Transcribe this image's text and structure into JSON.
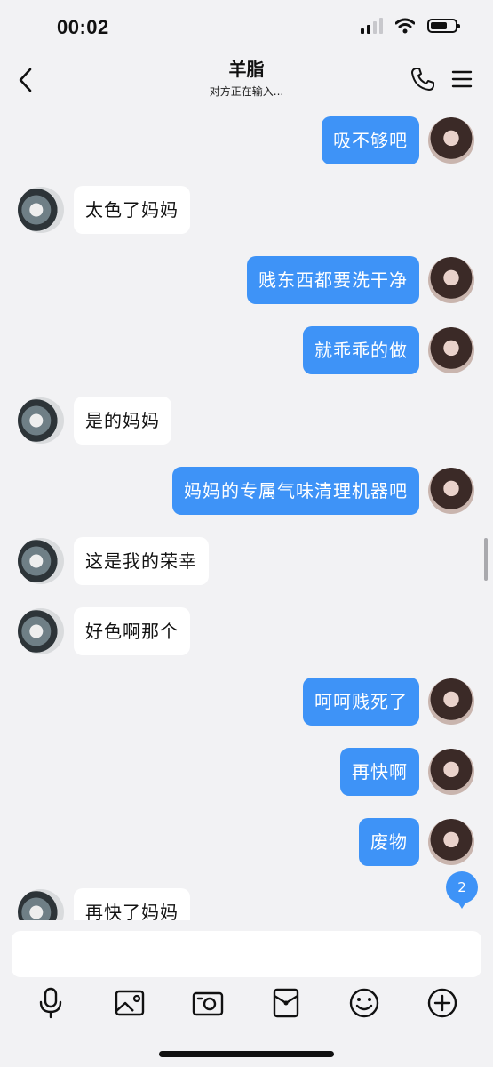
{
  "status_bar": {
    "time": "00:02"
  },
  "header": {
    "title": "羊脂",
    "subtitle": "对方正在输入..."
  },
  "messages": [
    {
      "side": "out",
      "text": "吸不够吧"
    },
    {
      "side": "in",
      "text": "太色了妈妈"
    },
    {
      "side": "out",
      "text": "贱东西都要洗干净"
    },
    {
      "side": "out",
      "text": "就乖乖的做"
    },
    {
      "side": "in",
      "text": "是的妈妈"
    },
    {
      "side": "out",
      "text": "妈妈的专属气味清理机器吧"
    },
    {
      "side": "in",
      "text": "这是我的荣幸"
    },
    {
      "side": "in",
      "text": "好色啊那个"
    },
    {
      "side": "out",
      "text": "呵呵贱死了"
    },
    {
      "side": "out",
      "text": "再快啊"
    },
    {
      "side": "out",
      "text": "废物"
    },
    {
      "side": "in",
      "text": "再快了妈妈"
    }
  ],
  "unread_badge": "2",
  "input": {
    "value": "",
    "placeholder": ""
  },
  "toolbar": [
    "mic-icon",
    "image-icon",
    "camera-icon",
    "red-packet-icon",
    "emoji-icon",
    "plus-icon"
  ],
  "colors": {
    "accent": "#3e93f7",
    "background": "#f2f2f4",
    "bubble_in": "#ffffff"
  }
}
